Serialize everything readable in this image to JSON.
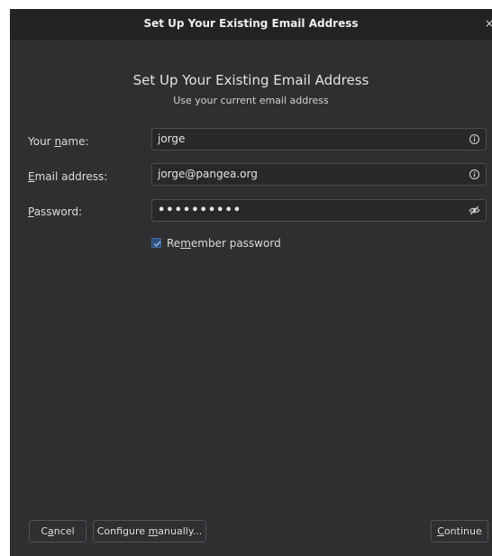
{
  "titlebar": {
    "title": "Set Up Your Existing Email Address",
    "close_glyph": "×"
  },
  "header": {
    "title": "Set Up Your Existing Email Address",
    "subtitle": "Use your current email address"
  },
  "form": {
    "name": {
      "label_pre": "Your ",
      "label_mnemonic": "n",
      "label_post": "ame:",
      "value": "jorge",
      "icon": "info-icon"
    },
    "email": {
      "label_pre": "",
      "label_mnemonic": "E",
      "label_post": "mail address:",
      "value": "jorge@pangea.org",
      "icon": "info-icon"
    },
    "password": {
      "label_pre": "",
      "label_mnemonic": "P",
      "label_post": "assword:",
      "value": "••••••••••",
      "icon": "eye-slash-icon"
    },
    "remember": {
      "label_pre": "Re",
      "label_mnemonic": "m",
      "label_post": "ember password",
      "checked": true
    }
  },
  "buttons": {
    "cancel": {
      "pre": "C",
      "mnemonic": "a",
      "post": "ncel"
    },
    "configure": {
      "pre": "Configure ",
      "mnemonic": "m",
      "post": "anually..."
    },
    "continue": {
      "pre": "",
      "mnemonic": "C",
      "post": "ontinue"
    }
  },
  "colors": {
    "window_bg": "#2f2f32",
    "titlebar_bg": "#232325",
    "field_bg": "#28282a",
    "checkbox_accent": "#3b6ea5"
  }
}
